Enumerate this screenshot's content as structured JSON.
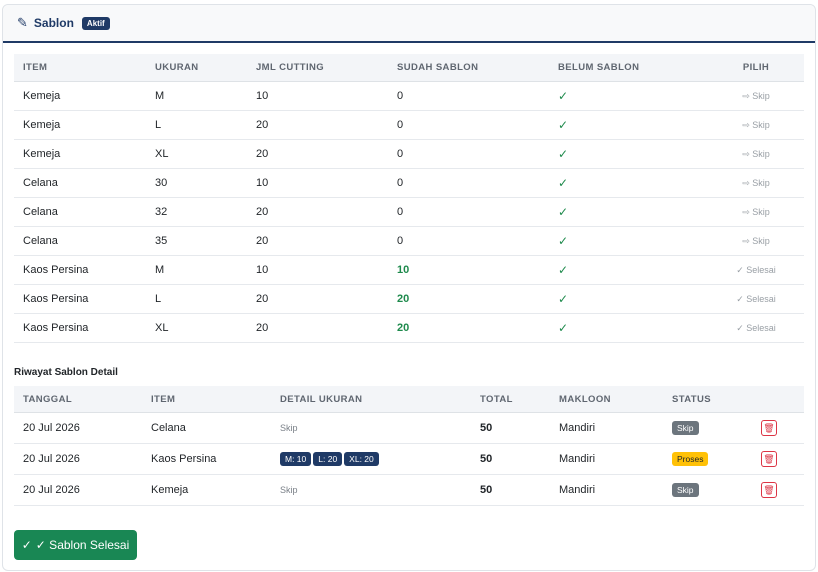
{
  "header": {
    "title": "Sablon",
    "badge": "Aktif",
    "icon": "pencil-icon"
  },
  "items_table": {
    "columns": [
      "ITEM",
      "UKURAN",
      "JML CUTTING",
      "SUDAH SABLON",
      "BELUM SABLON",
      "PILIH"
    ],
    "rows": [
      {
        "item": "Kemeja",
        "ukuran": "M",
        "jml": "10",
        "sudah": "0",
        "belum": "✓",
        "pilih": "Skip"
      },
      {
        "item": "Kemeja",
        "ukuran": "L",
        "jml": "20",
        "sudah": "0",
        "belum": "✓",
        "pilih": "Skip"
      },
      {
        "item": "Kemeja",
        "ukuran": "XL",
        "jml": "20",
        "sudah": "0",
        "belum": "✓",
        "pilih": "Skip"
      },
      {
        "item": "Celana",
        "ukuran": "30",
        "jml": "10",
        "sudah": "0",
        "belum": "✓",
        "pilih": "Skip"
      },
      {
        "item": "Celana",
        "ukuran": "32",
        "jml": "20",
        "sudah": "0",
        "belum": "✓",
        "pilih": "Skip"
      },
      {
        "item": "Celana",
        "ukuran": "35",
        "jml": "20",
        "sudah": "0",
        "belum": "✓",
        "pilih": "Skip"
      },
      {
        "item": "Kaos Persina",
        "ukuran": "M",
        "jml": "10",
        "sudah": "10",
        "belum": "✓",
        "pilih": "Selesai"
      },
      {
        "item": "Kaos Persina",
        "ukuran": "L",
        "jml": "20",
        "sudah": "20",
        "belum": "✓",
        "pilih": "Selesai"
      },
      {
        "item": "Kaos Persina",
        "ukuran": "XL",
        "jml": "20",
        "sudah": "20",
        "belum": "✓",
        "pilih": "Selesai"
      }
    ]
  },
  "riwayat": {
    "title": "Riwayat Sablon Detail",
    "columns": [
      "TANGGAL",
      "ITEM",
      "DETAIL UKURAN",
      "TOTAL",
      "MAKLOON",
      "STATUS"
    ],
    "rows": [
      {
        "tanggal": "20 Jul 2026",
        "item": "Celana",
        "detail_text": "Skip",
        "sizes": [],
        "total": "50",
        "makloon": "Mandiri",
        "status": "Skip"
      },
      {
        "tanggal": "20 Jul 2026",
        "item": "Kaos Persina",
        "detail_text": "",
        "sizes": [
          "M: 10",
          "L: 20",
          "XL: 20"
        ],
        "total": "50",
        "makloon": "Mandiri",
        "status": "Proses"
      },
      {
        "tanggal": "20 Jul 2026",
        "item": "Kemeja",
        "detail_text": "Skip",
        "sizes": [],
        "total": "50",
        "makloon": "Mandiri",
        "status": "Skip"
      }
    ]
  },
  "done_button": {
    "label": "✓ Sablon Selesai"
  },
  "colors": {
    "primary": "#1f3a66",
    "success": "#198754",
    "warning": "#ffc107",
    "danger": "#dc3545"
  }
}
